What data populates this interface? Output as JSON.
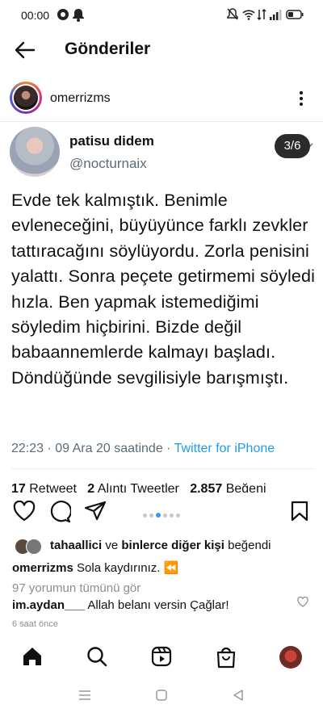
{
  "status_bar": {
    "time": "00:00"
  },
  "header": {
    "title": "Gönderiler"
  },
  "post": {
    "username": "omerrizms",
    "tweet": {
      "name": "patisu didem",
      "handle": "@nocturnaix",
      "counter": "3/6",
      "text": "Evde tek kalmıştık. Benimle evleneceğini, büyüyünce farklı zevkler tattıracağını söylüyordu. Zorla penisini yalattı. Sonra peçete getirmemi söyledi hızla. Ben yapmak istemediğimi söyledim hiçbirini. Bizde değil babaannemlerde kalmayı başladı. Döndüğünde sevgilisiyle barışmıştı.",
      "time": "22:23",
      "date": "· 09 Ara 20 saatinde ·",
      "source": "Twitter for iPhone",
      "stats": [
        {
          "count": "17",
          "label": "Retweet"
        },
        {
          "count": "2",
          "label": "Alıntı Tweetler"
        },
        {
          "count": "2.857",
          "label": "Beğeni"
        }
      ]
    },
    "likes": {
      "user": "tahaallici",
      "connector": "ve",
      "others": "binlerce diğer kişi",
      "suffix": "beğendi"
    },
    "caption": {
      "user": "omerrizms",
      "text": "Sola kaydırınız. ⏪"
    },
    "view_comments": "97 yorumun tümünü gör",
    "comment": {
      "user": "im.aydan___",
      "text": "Allah belanı versin Çağlar!"
    },
    "time_ago": "6 saat önce"
  },
  "icons": {
    "back": "back-arrow-icon",
    "more": "more-vertical-icon",
    "like": "heart-icon",
    "comment": "comment-icon",
    "share": "send-icon",
    "save": "bookmark-icon",
    "home": "home-icon",
    "search": "search-icon",
    "reels": "reels-icon",
    "shop": "shop-icon"
  },
  "colors": {
    "link": "#1d9bf0",
    "dot_active": "#3897f0",
    "muted": "#8e8e8e"
  }
}
